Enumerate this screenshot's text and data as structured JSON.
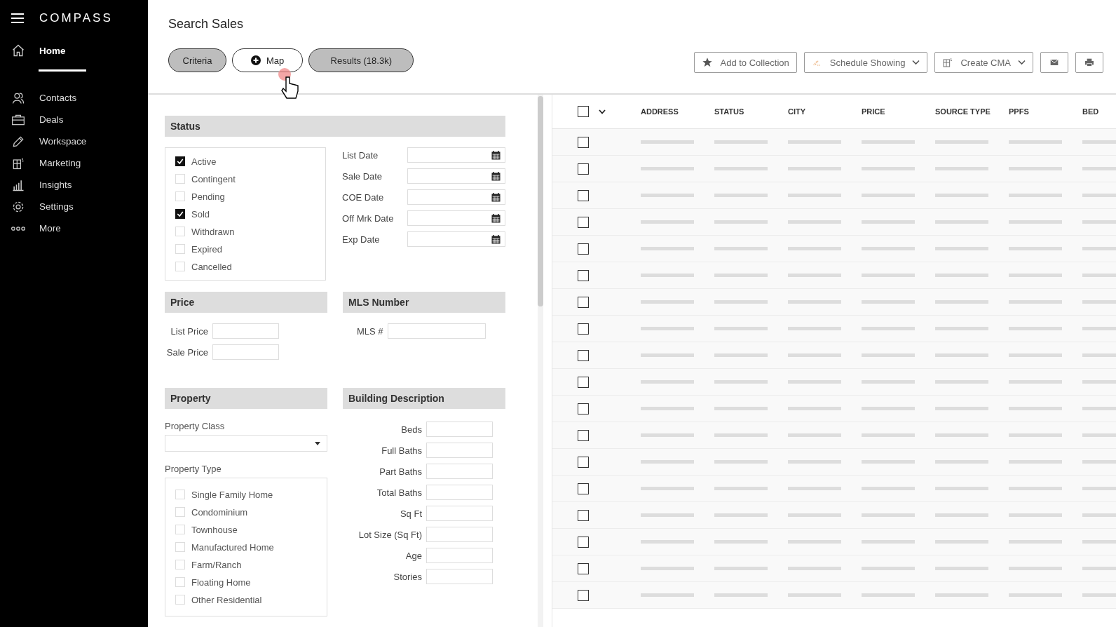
{
  "sidebar": {
    "logo": "COMPASS",
    "items": [
      {
        "label": "Home",
        "selected": true
      },
      {
        "label": "Contacts",
        "selected": false
      },
      {
        "label": "Deals",
        "selected": false
      },
      {
        "label": "Workspace",
        "selected": false
      },
      {
        "label": "Marketing",
        "selected": false
      },
      {
        "label": "Insights",
        "selected": false
      },
      {
        "label": "Settings",
        "selected": false
      },
      {
        "label": "More",
        "selected": false
      }
    ]
  },
  "page_title": "Search Sales",
  "tabs": [
    {
      "label": "Criteria",
      "selected": true
    },
    {
      "label": "Map",
      "selected": false
    },
    {
      "label": "Results (18.3k)",
      "selected": true
    }
  ],
  "toolbar": [
    {
      "kind": "button",
      "label": "Add to Collection"
    },
    {
      "kind": "dropdown",
      "label": "Schedule Showing"
    },
    {
      "kind": "dropdown",
      "label": "Create CMA"
    },
    {
      "kind": "icon"
    },
    {
      "kind": "icon"
    }
  ],
  "status": {
    "title": "Status",
    "options": [
      {
        "label": "Active",
        "checked": true
      },
      {
        "label": "Contingent",
        "checked": false
      },
      {
        "label": "Pending",
        "checked": false
      },
      {
        "label": "Sold",
        "checked": true
      },
      {
        "label": "Withdrawn",
        "checked": false
      },
      {
        "label": "Expired",
        "checked": false
      },
      {
        "label": "Cancelled",
        "checked": false
      }
    ],
    "dates": [
      "List Date",
      "Sale Date",
      "COE Date",
      "Off Mrk Date",
      "Exp Date"
    ]
  },
  "price": {
    "title": "Price",
    "fields": [
      "List Price",
      "Sale Price"
    ]
  },
  "mls": {
    "title": "MLS Number",
    "fields": [
      "MLS #"
    ]
  },
  "property": {
    "title": "Property",
    "class_label": "Property Class",
    "type_label": "Property Type",
    "types": [
      {
        "label": "Single Family Home",
        "checked": false
      },
      {
        "label": "Condominium",
        "checked": false
      },
      {
        "label": "Townhouse",
        "checked": false
      },
      {
        "label": "Manufactured Home",
        "checked": false
      },
      {
        "label": "Farm/Ranch",
        "checked": false
      },
      {
        "label": "Floating Home",
        "checked": false
      },
      {
        "label": "Other Residential",
        "checked": false
      }
    ]
  },
  "building": {
    "title": "Building Description",
    "fields": [
      "Beds",
      "Full Baths",
      "Part Baths",
      "Total Baths",
      "Sq Ft",
      "Lot Size (Sq Ft)",
      "Age",
      "Stories"
    ]
  },
  "table": {
    "select_all": {
      "checked": false
    },
    "columns": [
      "ADDRESS",
      "STATUS",
      "CITY",
      "PRICE",
      "SOURCE TYPE",
      "PPFS",
      "BED"
    ],
    "rows": [
      {
        "checked": false
      },
      {
        "checked": false
      },
      {
        "checked": false
      },
      {
        "checked": false
      },
      {
        "checked": false
      },
      {
        "checked": false
      },
      {
        "checked": false
      },
      {
        "checked": false
      },
      {
        "checked": false
      },
      {
        "checked": false
      },
      {
        "checked": false
      },
      {
        "checked": false
      },
      {
        "checked": false
      },
      {
        "checked": false
      },
      {
        "checked": false
      },
      {
        "checked": false
      },
      {
        "checked": false
      },
      {
        "checked": false
      }
    ]
  }
}
